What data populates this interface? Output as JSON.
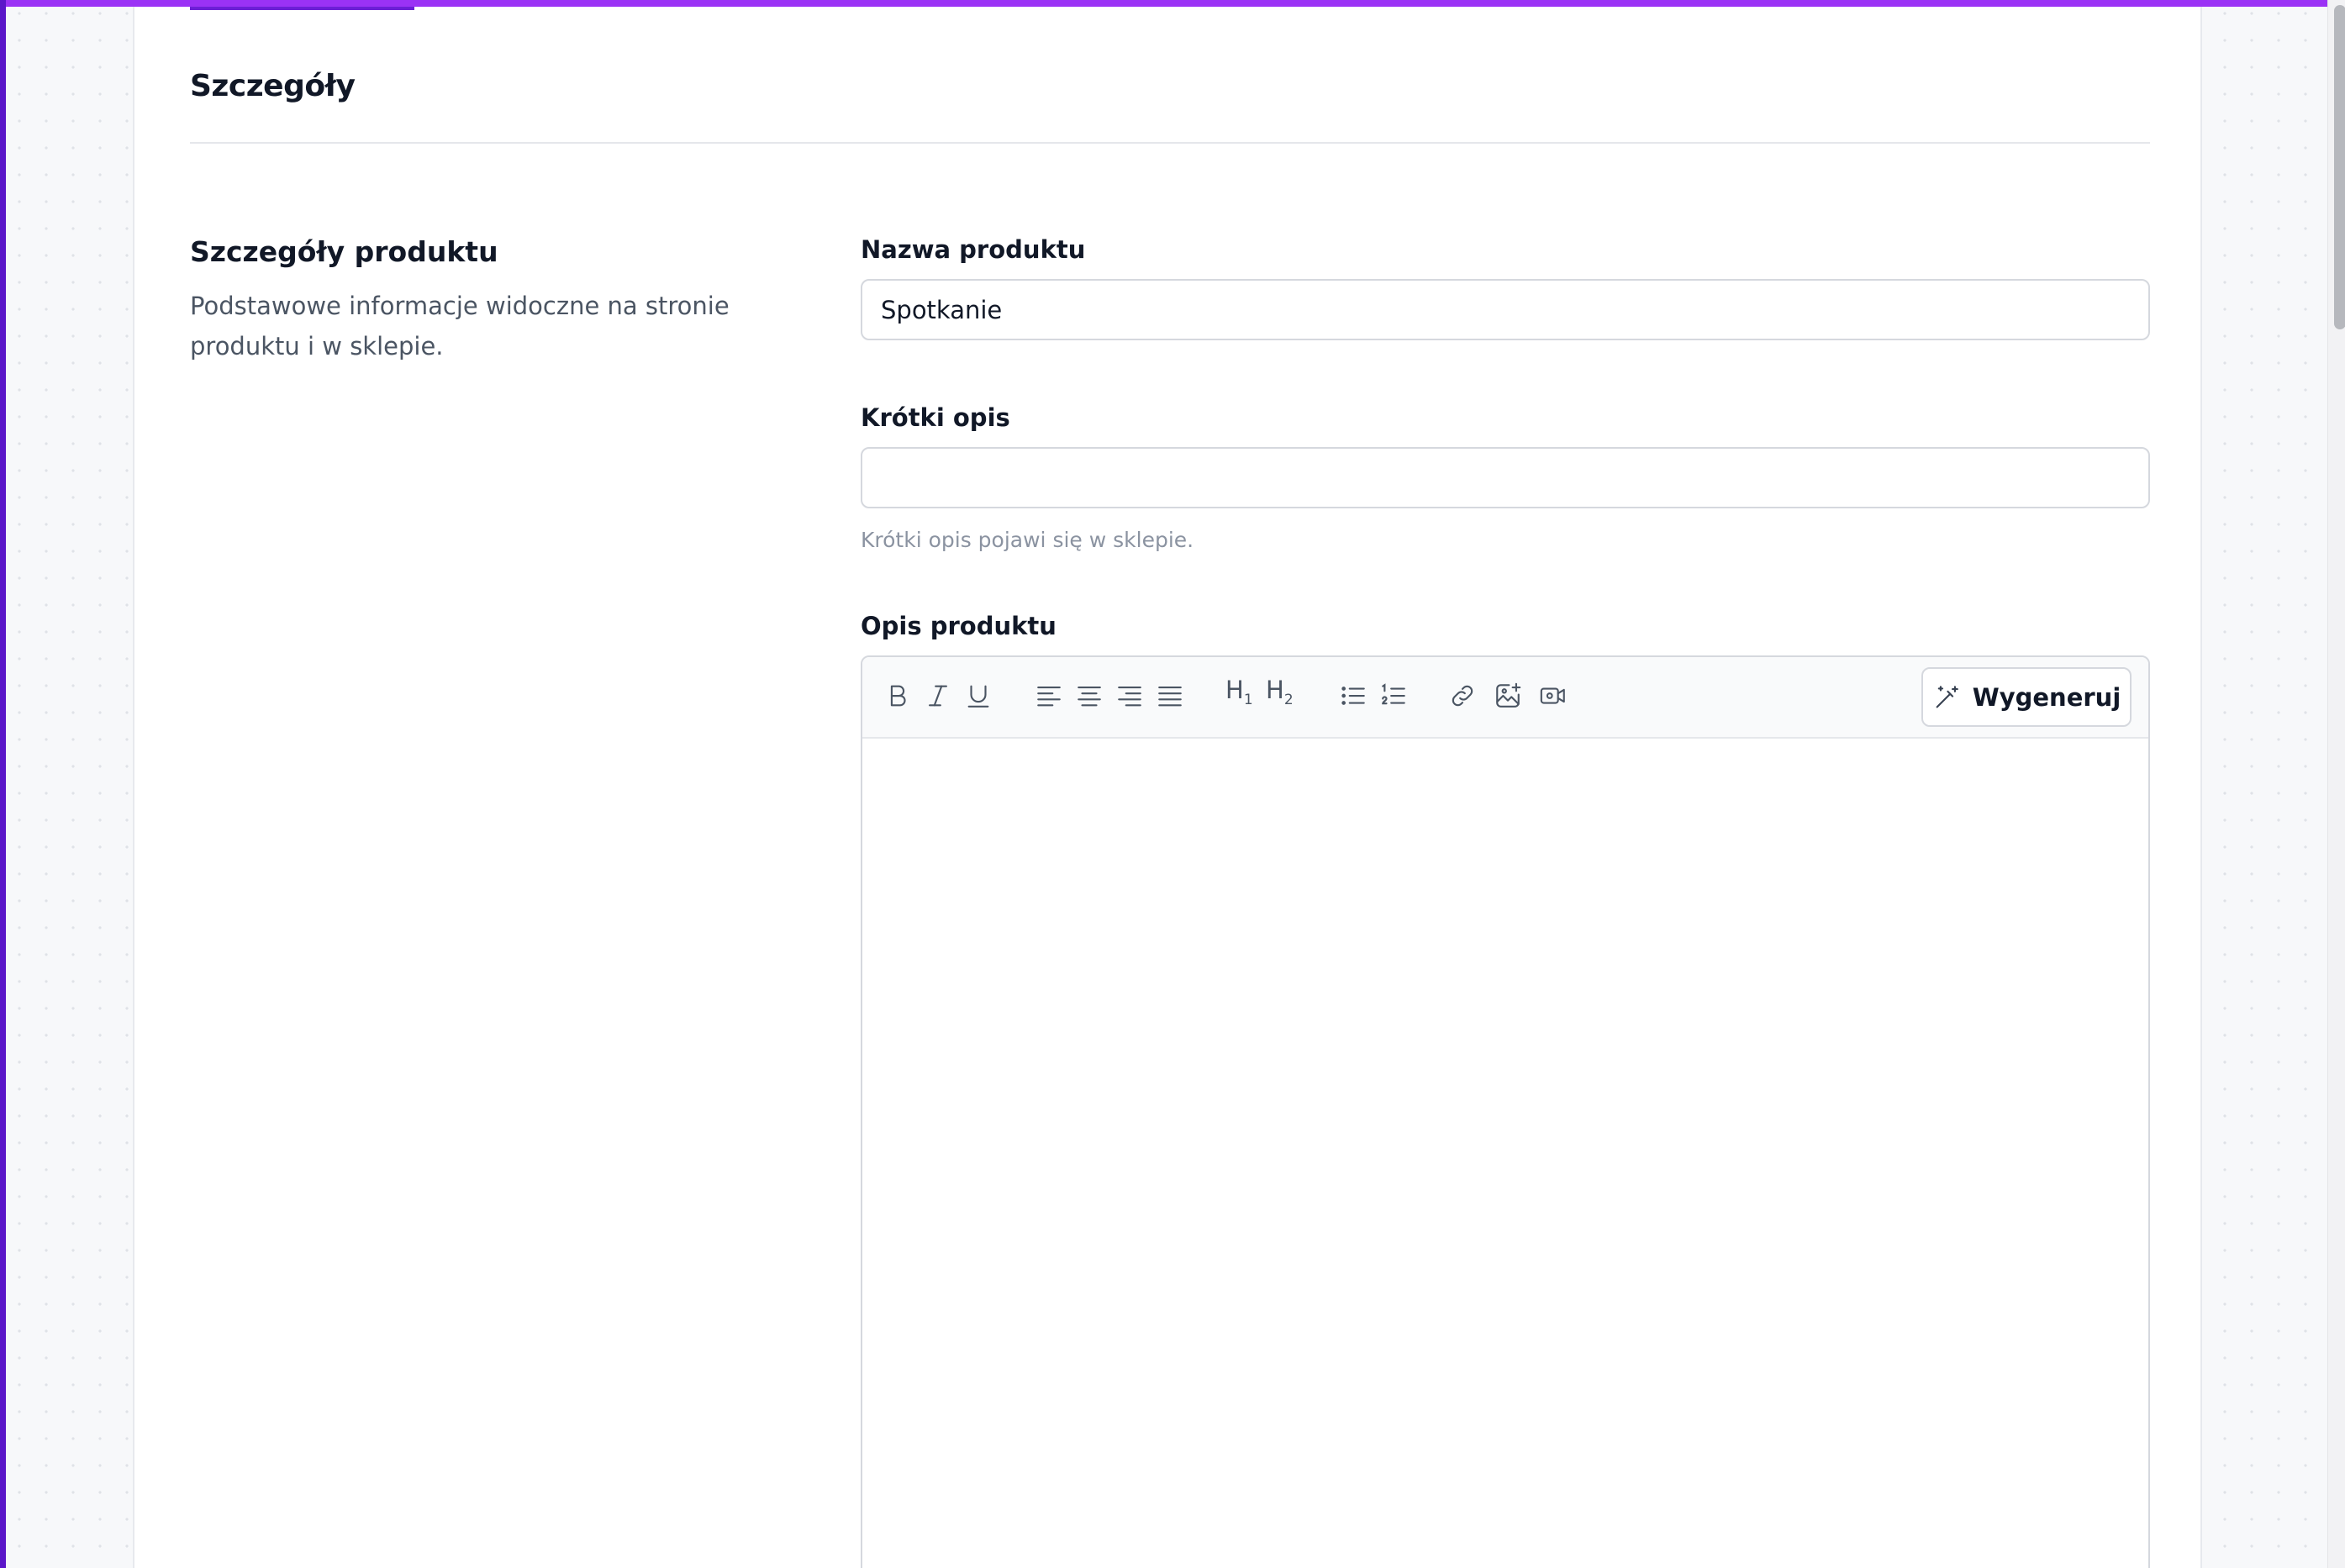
{
  "page": {
    "title": "Szczegóły"
  },
  "section": {
    "title": "Szczegóły produktu",
    "description": "Podstawowe informacje widoczne na stronie produktu i w sklepie."
  },
  "fields": {
    "name": {
      "label": "Nazwa produktu",
      "value": "Spotkanie"
    },
    "short_description": {
      "label": "Krótki opis",
      "value": "",
      "hint": "Krótki opis pojawi się w sklepie."
    },
    "description": {
      "label": "Opis produktu",
      "value": ""
    }
  },
  "toolbar": {
    "h1": "H",
    "h1_sub": "1",
    "h2": "H",
    "h2_sub": "2",
    "generate_label": "Wygeneruj",
    "icons": [
      "bold-icon",
      "italic-icon",
      "underline-icon",
      "align-left-icon",
      "align-center-icon",
      "align-right-icon",
      "align-justify-icon",
      "heading-1-icon",
      "heading-2-icon",
      "bullet-list-icon",
      "numbered-list-icon",
      "link-icon",
      "image-icon",
      "video-icon",
      "magic-wand-icon"
    ]
  },
  "colors": {
    "accent": "#9b32f5",
    "accent_dark": "#5b16c9",
    "text": "#111827",
    "muted": "#4b5563",
    "hint": "#8b93a1",
    "border": "#d5d8de"
  }
}
